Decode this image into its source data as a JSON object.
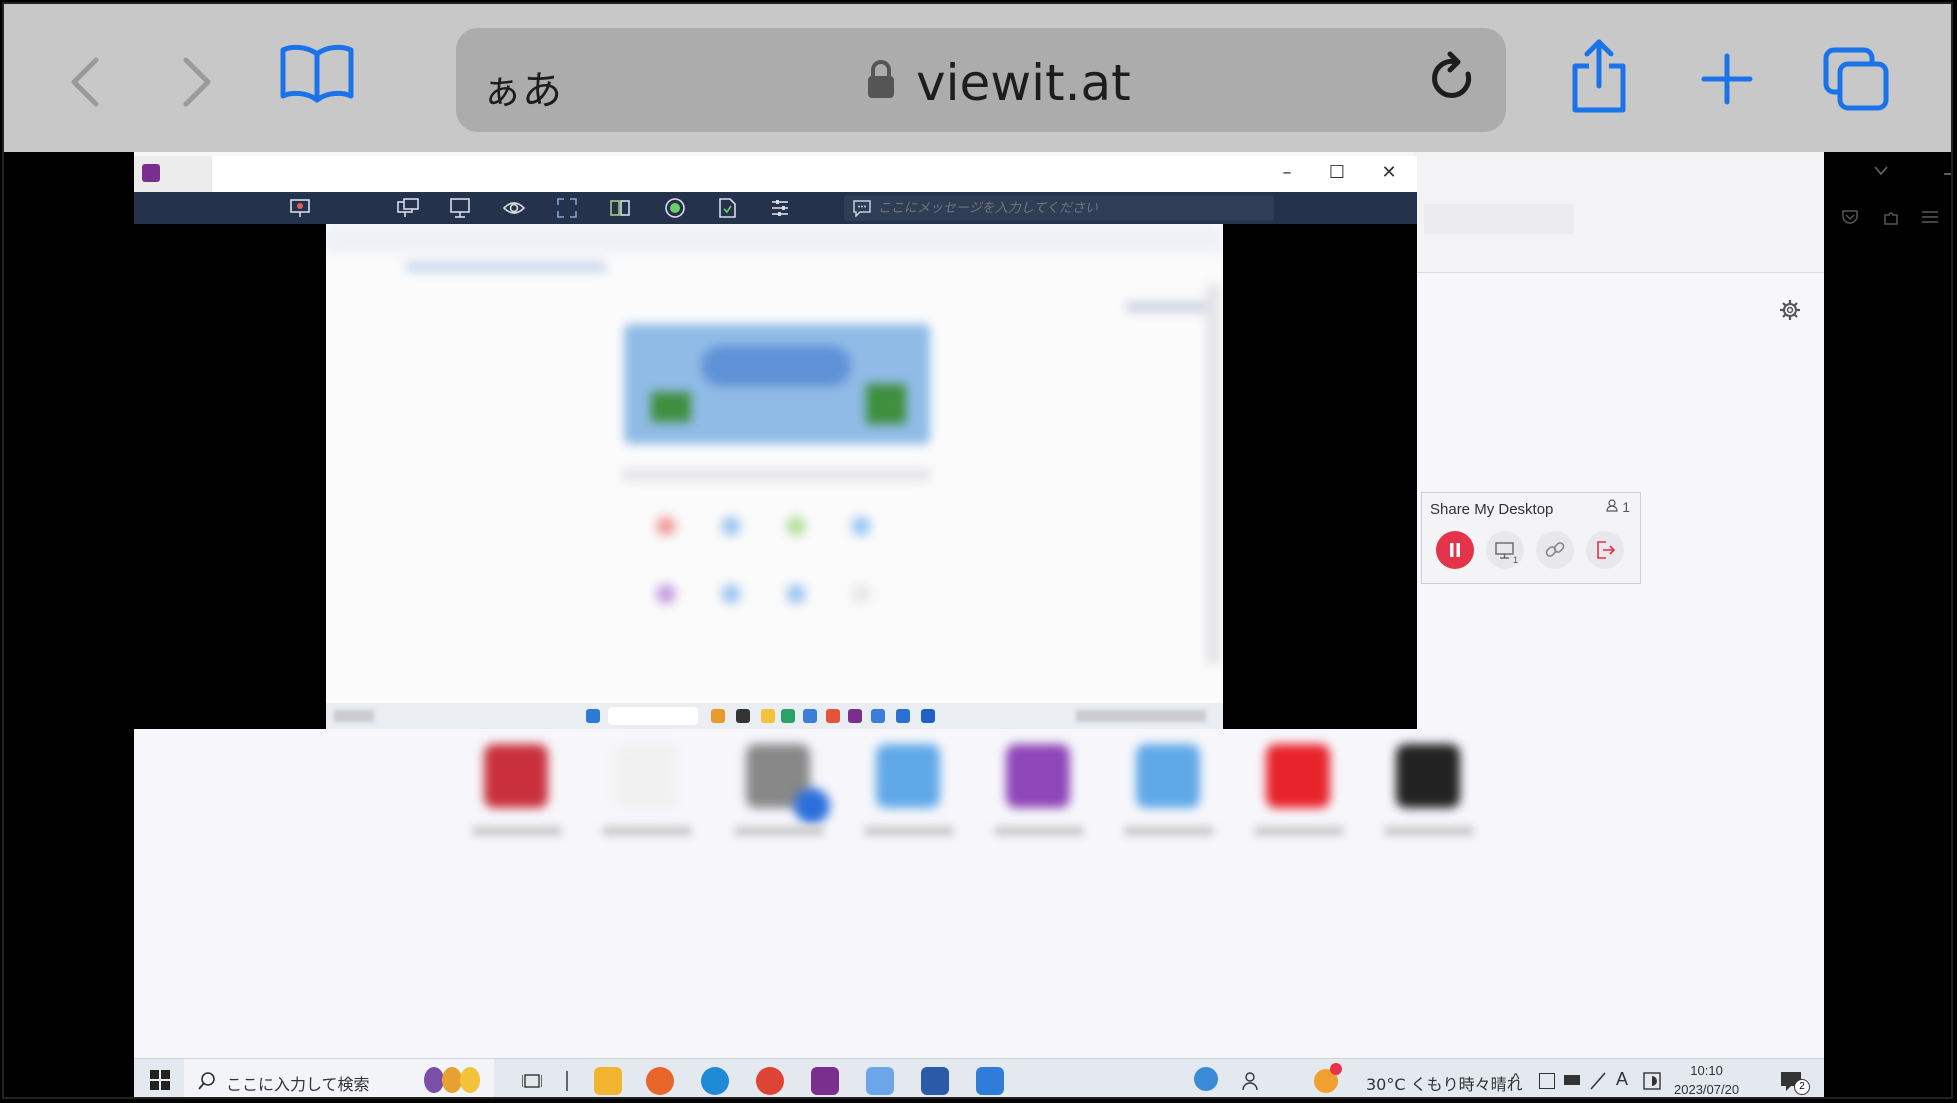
{
  "safari": {
    "aa_label": "ぁあ",
    "url": "viewit.at"
  },
  "viewer": {
    "message_placeholder": "ここにメッセージを入力してください"
  },
  "share_panel": {
    "title": "Share My Desktop",
    "viewer_count": "1",
    "screen_number": "1"
  },
  "taskbar": {
    "search_placeholder": "ここに入力して検索",
    "weather": "30°C くもり時々晴れ",
    "time": "10:10",
    "date": "2023/07/20",
    "notification_count": "2",
    "ime_label": "A"
  },
  "colors": {
    "safari_accent": "#1a73e8",
    "pause_button": "#e5334b",
    "viewer_toolbar": "#24324b"
  }
}
